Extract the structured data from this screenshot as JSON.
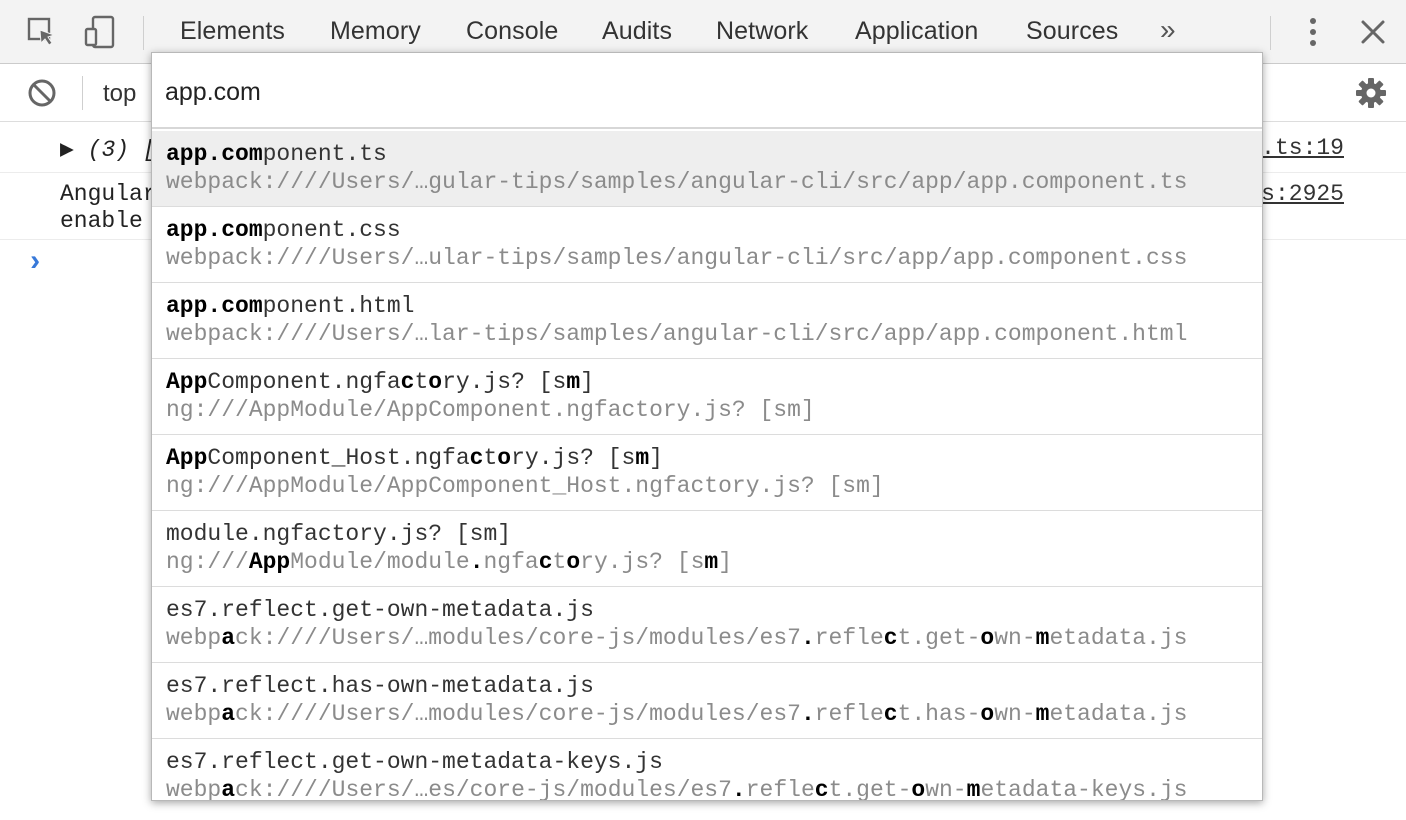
{
  "tabs": [
    "Elements",
    "Memory",
    "Console",
    "Audits",
    "Network",
    "Application",
    "Sources"
  ],
  "tabs_more": "»",
  "toolbar": {
    "context": "top"
  },
  "console": {
    "messages": [
      {
        "text": "▶ (3) [",
        "source": ".ts:19"
      },
      {
        "text": "Angular\nenable",
        "source": "s:2925"
      }
    ],
    "prompt": "›"
  },
  "quickopen": {
    "query": "app.com",
    "items": [
      {
        "title": [
          "<b>app.com</b>ponent.ts"
        ],
        "subtitle": "webpack:////Users/…gular-tips/samples/angular-cli/src/app/app.component.ts",
        "selected": true
      },
      {
        "title": [
          "<b>app.com</b>ponent.css"
        ],
        "subtitle": "webpack:////Users/…ular-tips/samples/angular-cli/src/app/app.component.css"
      },
      {
        "title": [
          "<b>app.com</b>ponent.html"
        ],
        "subtitle": "webpack:////Users/…lar-tips/samples/angular-cli/src/app/app.component.html"
      },
      {
        "title": [
          "<b>App</b>Component.ngfa<b>c</b>t<b>o</b>ry.js? [s<b>m</b>]"
        ],
        "subtitle": "ng:///AppModule/AppComponent.ngfactory.js? [sm]"
      },
      {
        "title": [
          "<b>App</b>Component_Host.ngfa<b>c</b>t<b>o</b>ry.js? [s<b>m</b>]"
        ],
        "subtitle": "ng:///AppModule/AppComponent_Host.ngfactory.js? [sm]"
      },
      {
        "title": [
          "module.ngfactory.js? [sm]"
        ],
        "subtitle_html": "ng:///<b>App</b>Module/module<b>.</b>ngfa<b>c</b>t<b>o</b>ry.js? [s<b>m</b>]"
      },
      {
        "title": [
          "es7.reflect.get-own-metadata.js"
        ],
        "subtitle_html": "webp<b>a</b>ck:////Users/…modules/core-js/modules/es7<b>.</b>refle<b>c</b>t.get-<b>o</b>wn-<b>m</b>etadata.js"
      },
      {
        "title": [
          "es7.reflect.has-own-metadata.js"
        ],
        "subtitle_html": "webp<b>a</b>ck:////Users/…modules/core-js/modules/es7<b>.</b>refle<b>c</b>t.has-<b>o</b>wn-<b>m</b>etadata.js"
      },
      {
        "title": [
          "es7.reflect.get-own-metadata-keys.js"
        ],
        "subtitle_html": "webp<b>a</b>ck:////Users/…es/core-js/modules/es7<b>.</b>refle<b>c</b>t.get-<b>o</b>wn-<b>m</b>etadata-keys.js"
      }
    ]
  },
  "colors": {
    "accent": "#1a73e8",
    "prompt": "#3879d9"
  }
}
